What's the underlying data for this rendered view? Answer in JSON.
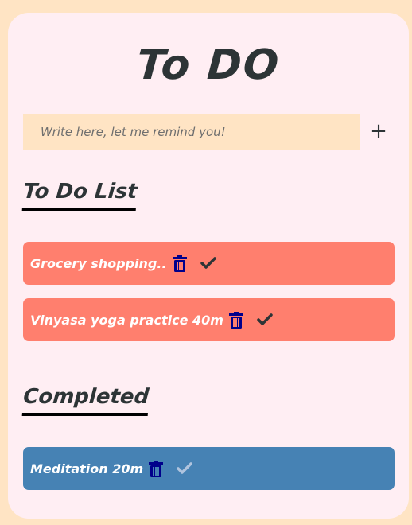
{
  "app": {
    "title": "To DO"
  },
  "input": {
    "placeholder": "Write here, let me remind you!",
    "value": "",
    "add_label": "+"
  },
  "todo_section": {
    "heading": "To Do List",
    "items": [
      {
        "label": "Grocery shopping.."
      },
      {
        "label": "Vinyasa yoga practice 40m"
      }
    ]
  },
  "completed_section": {
    "heading": "Completed",
    "items": [
      {
        "label": "Meditation 20m"
      }
    ]
  },
  "colors": {
    "page_background": "#ffe4c4",
    "card_background": "#ffeef3",
    "todo_item": "#ff7f6e",
    "completed_item": "#4682b4",
    "trash_icon": "#00008b",
    "check_icon_todo": "#2d3436",
    "check_icon_done": "#b0c4de",
    "text_dark": "#2d3436"
  },
  "icons": {
    "delete": "trash-icon",
    "complete": "check-icon",
    "add": "plus-icon"
  }
}
